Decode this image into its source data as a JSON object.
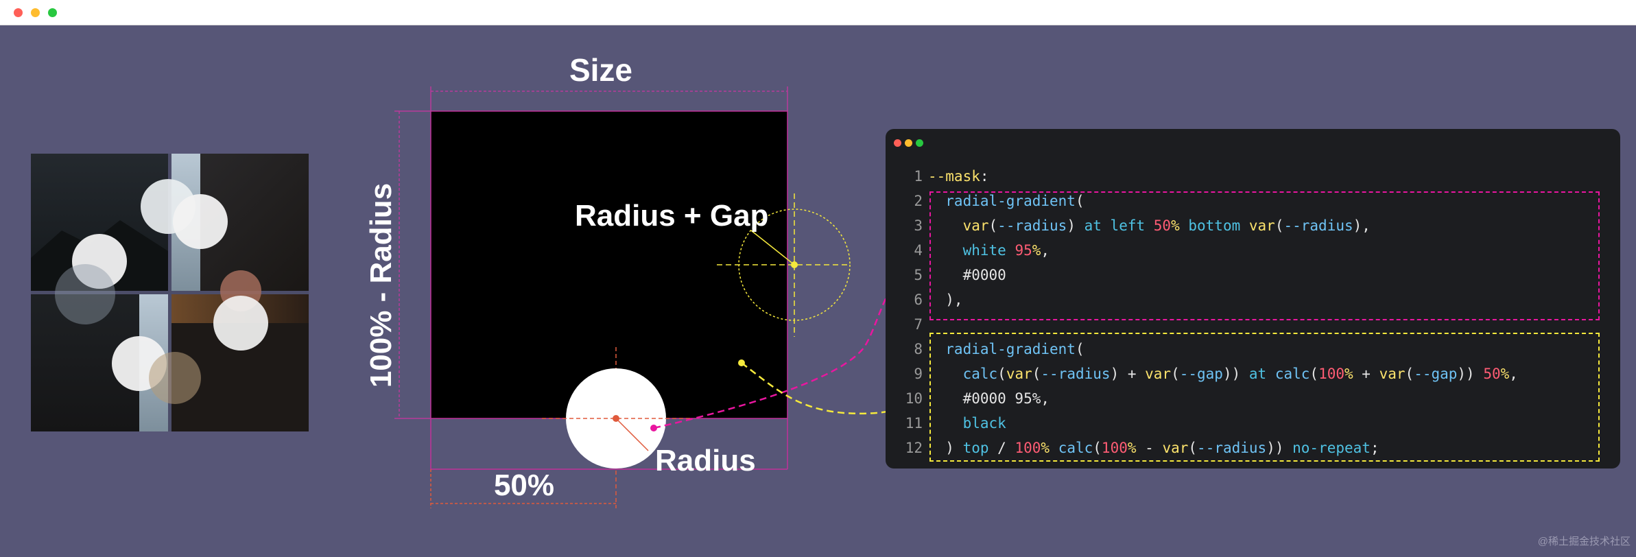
{
  "window": {
    "dots": [
      "#ff5f57",
      "#febc2e",
      "#28c840"
    ]
  },
  "diagram": {
    "size_label": "Size",
    "height_label": "100% - Radius",
    "radius_gap_label": "Radius + Gap",
    "radius_label": "Radius",
    "half_label": "50%",
    "colors": {
      "magenta": "#e9169f",
      "yellow": "#f5e93c",
      "circle": "#ffffff",
      "box": "#000000",
      "red": "#e05a3c"
    }
  },
  "code": {
    "dots": [
      "#ff5f57",
      "#febc2e",
      "#28c840"
    ],
    "lines": [
      {
        "n": "1",
        "tokens": [
          {
            "t": "--mask",
            "c": "c-var"
          },
          {
            "t": ":",
            "c": "c-w"
          }
        ]
      },
      {
        "n": "2",
        "tokens": [
          {
            "t": "  radial-gradient",
            "c": "c-fn"
          },
          {
            "t": "(",
            "c": "c-w"
          }
        ]
      },
      {
        "n": "3",
        "tokens": [
          {
            "t": "    var",
            "c": "c-var"
          },
          {
            "t": "(",
            "c": "c-w"
          },
          {
            "t": "--radius",
            "c": "c-fn"
          },
          {
            "t": ") ",
            "c": "c-w"
          },
          {
            "t": "at left ",
            "c": "c-kw"
          },
          {
            "t": "50",
            "c": "c-num"
          },
          {
            "t": "% ",
            "c": "c-var"
          },
          {
            "t": "bottom ",
            "c": "c-kw"
          },
          {
            "t": "var",
            "c": "c-var"
          },
          {
            "t": "(",
            "c": "c-w"
          },
          {
            "t": "--radius",
            "c": "c-fn"
          },
          {
            "t": "),",
            "c": "c-w"
          }
        ]
      },
      {
        "n": "4",
        "tokens": [
          {
            "t": "    white ",
            "c": "c-kw"
          },
          {
            "t": "95",
            "c": "c-num"
          },
          {
            "t": "%",
            "c": "c-var"
          },
          {
            "t": ",",
            "c": "c-w"
          }
        ]
      },
      {
        "n": "5",
        "tokens": [
          {
            "t": "    #0000",
            "c": "c-w"
          }
        ]
      },
      {
        "n": "6",
        "tokens": [
          {
            "t": "  ),",
            "c": "c-w"
          }
        ]
      },
      {
        "n": "7",
        "tokens": []
      },
      {
        "n": "8",
        "tokens": [
          {
            "t": "  radial-gradient",
            "c": "c-fn"
          },
          {
            "t": "(",
            "c": "c-w"
          }
        ]
      },
      {
        "n": "9",
        "tokens": [
          {
            "t": "    calc",
            "c": "c-fn"
          },
          {
            "t": "(",
            "c": "c-w"
          },
          {
            "t": "var",
            "c": "c-var"
          },
          {
            "t": "(",
            "c": "c-w"
          },
          {
            "t": "--radius",
            "c": "c-fn"
          },
          {
            "t": ") + ",
            "c": "c-w"
          },
          {
            "t": "var",
            "c": "c-var"
          },
          {
            "t": "(",
            "c": "c-w"
          },
          {
            "t": "--gap",
            "c": "c-fn"
          },
          {
            "t": ")) ",
            "c": "c-w"
          },
          {
            "t": "at ",
            "c": "c-kw"
          },
          {
            "t": "calc",
            "c": "c-fn"
          },
          {
            "t": "(",
            "c": "c-w"
          },
          {
            "t": "100",
            "c": "c-num"
          },
          {
            "t": "%",
            "c": "c-var"
          },
          {
            "t": " + ",
            "c": "c-w"
          },
          {
            "t": "var",
            "c": "c-var"
          },
          {
            "t": "(",
            "c": "c-w"
          },
          {
            "t": "--gap",
            "c": "c-fn"
          },
          {
            "t": ")) ",
            "c": "c-w"
          },
          {
            "t": "50",
            "c": "c-num"
          },
          {
            "t": "%",
            "c": "c-var"
          },
          {
            "t": ",",
            "c": "c-w"
          }
        ]
      },
      {
        "n": "10",
        "tokens": [
          {
            "t": "    #0000 95%,",
            "c": "c-w"
          }
        ]
      },
      {
        "n": "11",
        "tokens": [
          {
            "t": "    black",
            "c": "c-kw"
          }
        ]
      },
      {
        "n": "12",
        "tokens": [
          {
            "t": "  ) ",
            "c": "c-w"
          },
          {
            "t": "top ",
            "c": "c-kw"
          },
          {
            "t": "/ ",
            "c": "c-w"
          },
          {
            "t": "100",
            "c": "c-num"
          },
          {
            "t": "% ",
            "c": "c-var"
          },
          {
            "t": "calc",
            "c": "c-fn"
          },
          {
            "t": "(",
            "c": "c-w"
          },
          {
            "t": "100",
            "c": "c-num"
          },
          {
            "t": "%",
            "c": "c-var"
          },
          {
            "t": " - ",
            "c": "c-w"
          },
          {
            "t": "var",
            "c": "c-var"
          },
          {
            "t": "(",
            "c": "c-w"
          },
          {
            "t": "--radius",
            "c": "c-fn"
          },
          {
            "t": ")) ",
            "c": "c-w"
          },
          {
            "t": "no-repeat",
            "c": "c-kw"
          },
          {
            "t": ";",
            "c": "c-w"
          }
        ]
      }
    ]
  },
  "watermark": "@稀土掘金技术社区"
}
